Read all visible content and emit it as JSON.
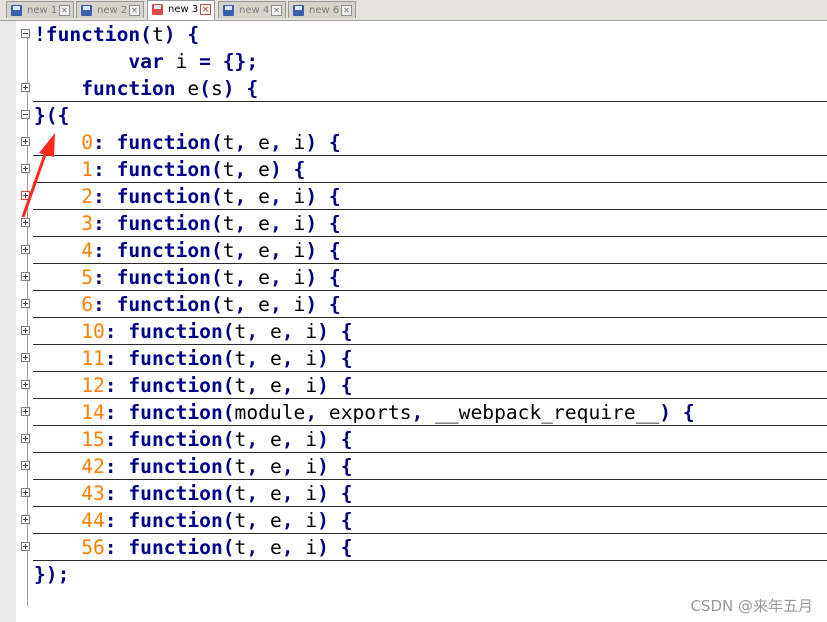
{
  "tabs": [
    {
      "label": "new 1",
      "active": false
    },
    {
      "label": "new 2",
      "active": false
    },
    {
      "label": "new 3",
      "active": true
    },
    {
      "label": "new 4",
      "active": false
    },
    {
      "label": "new 6",
      "active": false
    }
  ],
  "code_lines": [
    {
      "fold": "minus",
      "tokens": [
        [
          "op",
          "!"
        ],
        [
          "kw",
          "function"
        ],
        [
          "op",
          "("
        ],
        [
          "id",
          "t"
        ],
        [
          "op",
          ")"
        ],
        [
          "ws",
          " "
        ],
        [
          "op",
          "{"
        ]
      ]
    },
    {
      "fold": "",
      "tokens": [
        [
          "ws",
          "        "
        ],
        [
          "kw",
          "var"
        ],
        [
          "ws",
          " "
        ],
        [
          "id",
          "i"
        ],
        [
          "ws",
          " "
        ],
        [
          "op",
          "="
        ],
        [
          "ws",
          " "
        ],
        [
          "op",
          "{};"
        ]
      ]
    },
    {
      "fold": "plus",
      "tokens": [
        [
          "ws",
          "    "
        ],
        [
          "kw",
          "function"
        ],
        [
          "ws",
          " "
        ],
        [
          "id",
          "e"
        ],
        [
          "op",
          "("
        ],
        [
          "id",
          "s"
        ],
        [
          "op",
          ")"
        ],
        [
          "ws",
          " "
        ],
        [
          "op",
          "{"
        ]
      ]
    },
    {
      "fold": "minus",
      "tokens": [
        [
          "op",
          "}({"
        ]
      ]
    },
    {
      "fold": "plus",
      "tokens": [
        [
          "ws",
          "    "
        ],
        [
          "num",
          "0"
        ],
        [
          "op",
          ":"
        ],
        [
          "ws",
          " "
        ],
        [
          "kw",
          "function"
        ],
        [
          "op",
          "("
        ],
        [
          "id",
          "t"
        ],
        [
          "op",
          ","
        ],
        [
          "ws",
          " "
        ],
        [
          "id",
          "e"
        ],
        [
          "op",
          ","
        ],
        [
          "ws",
          " "
        ],
        [
          "id",
          "i"
        ],
        [
          "op",
          ")"
        ],
        [
          "ws",
          " "
        ],
        [
          "op",
          "{"
        ]
      ]
    },
    {
      "fold": "plus",
      "tokens": [
        [
          "ws",
          "    "
        ],
        [
          "num",
          "1"
        ],
        [
          "op",
          ":"
        ],
        [
          "ws",
          " "
        ],
        [
          "kw",
          "function"
        ],
        [
          "op",
          "("
        ],
        [
          "id",
          "t"
        ],
        [
          "op",
          ","
        ],
        [
          "ws",
          " "
        ],
        [
          "id",
          "e"
        ],
        [
          "op",
          ")"
        ],
        [
          "ws",
          " "
        ],
        [
          "op",
          "{"
        ]
      ]
    },
    {
      "fold": "plus-red",
      "tokens": [
        [
          "ws",
          "    "
        ],
        [
          "num",
          "2"
        ],
        [
          "op",
          ":"
        ],
        [
          "ws",
          " "
        ],
        [
          "kw",
          "function"
        ],
        [
          "op",
          "("
        ],
        [
          "id",
          "t"
        ],
        [
          "op",
          ","
        ],
        [
          "ws",
          " "
        ],
        [
          "id",
          "e"
        ],
        [
          "op",
          ","
        ],
        [
          "ws",
          " "
        ],
        [
          "id",
          "i"
        ],
        [
          "op",
          ")"
        ],
        [
          "ws",
          " "
        ],
        [
          "op",
          "{"
        ]
      ]
    },
    {
      "fold": "plus",
      "tokens": [
        [
          "ws",
          "    "
        ],
        [
          "num",
          "3"
        ],
        [
          "op",
          ":"
        ],
        [
          "ws",
          " "
        ],
        [
          "kw",
          "function"
        ],
        [
          "op",
          "("
        ],
        [
          "id",
          "t"
        ],
        [
          "op",
          ","
        ],
        [
          "ws",
          " "
        ],
        [
          "id",
          "e"
        ],
        [
          "op",
          ","
        ],
        [
          "ws",
          " "
        ],
        [
          "id",
          "i"
        ],
        [
          "op",
          ")"
        ],
        [
          "ws",
          " "
        ],
        [
          "op",
          "{"
        ]
      ]
    },
    {
      "fold": "plus",
      "tokens": [
        [
          "ws",
          "    "
        ],
        [
          "num",
          "4"
        ],
        [
          "op",
          ":"
        ],
        [
          "ws",
          " "
        ],
        [
          "kw",
          "function"
        ],
        [
          "op",
          "("
        ],
        [
          "id",
          "t"
        ],
        [
          "op",
          ","
        ],
        [
          "ws",
          " "
        ],
        [
          "id",
          "e"
        ],
        [
          "op",
          ","
        ],
        [
          "ws",
          " "
        ],
        [
          "id",
          "i"
        ],
        [
          "op",
          ")"
        ],
        [
          "ws",
          " "
        ],
        [
          "op",
          "{"
        ]
      ]
    },
    {
      "fold": "plus",
      "tokens": [
        [
          "ws",
          "    "
        ],
        [
          "num",
          "5"
        ],
        [
          "op",
          ":"
        ],
        [
          "ws",
          " "
        ],
        [
          "kw",
          "function"
        ],
        [
          "op",
          "("
        ],
        [
          "id",
          "t"
        ],
        [
          "op",
          ","
        ],
        [
          "ws",
          " "
        ],
        [
          "id",
          "e"
        ],
        [
          "op",
          ","
        ],
        [
          "ws",
          " "
        ],
        [
          "id",
          "i"
        ],
        [
          "op",
          ")"
        ],
        [
          "ws",
          " "
        ],
        [
          "op",
          "{"
        ]
      ]
    },
    {
      "fold": "plus",
      "tokens": [
        [
          "ws",
          "    "
        ],
        [
          "num",
          "6"
        ],
        [
          "op",
          ":"
        ],
        [
          "ws",
          " "
        ],
        [
          "kw",
          "function"
        ],
        [
          "op",
          "("
        ],
        [
          "id",
          "t"
        ],
        [
          "op",
          ","
        ],
        [
          "ws",
          " "
        ],
        [
          "id",
          "e"
        ],
        [
          "op",
          ","
        ],
        [
          "ws",
          " "
        ],
        [
          "id",
          "i"
        ],
        [
          "op",
          ")"
        ],
        [
          "ws",
          " "
        ],
        [
          "op",
          "{"
        ]
      ]
    },
    {
      "fold": "plus",
      "tokens": [
        [
          "ws",
          "    "
        ],
        [
          "num",
          "10"
        ],
        [
          "op",
          ":"
        ],
        [
          "ws",
          " "
        ],
        [
          "kw",
          "function"
        ],
        [
          "op",
          "("
        ],
        [
          "id",
          "t"
        ],
        [
          "op",
          ","
        ],
        [
          "ws",
          " "
        ],
        [
          "id",
          "e"
        ],
        [
          "op",
          ","
        ],
        [
          "ws",
          " "
        ],
        [
          "id",
          "i"
        ],
        [
          "op",
          ")"
        ],
        [
          "ws",
          " "
        ],
        [
          "op",
          "{"
        ]
      ]
    },
    {
      "fold": "plus",
      "tokens": [
        [
          "ws",
          "    "
        ],
        [
          "num",
          "11"
        ],
        [
          "op",
          ":"
        ],
        [
          "ws",
          " "
        ],
        [
          "kw",
          "function"
        ],
        [
          "op",
          "("
        ],
        [
          "id",
          "t"
        ],
        [
          "op",
          ","
        ],
        [
          "ws",
          " "
        ],
        [
          "id",
          "e"
        ],
        [
          "op",
          ","
        ],
        [
          "ws",
          " "
        ],
        [
          "id",
          "i"
        ],
        [
          "op",
          ")"
        ],
        [
          "ws",
          " "
        ],
        [
          "op",
          "{"
        ]
      ]
    },
    {
      "fold": "plus",
      "tokens": [
        [
          "ws",
          "    "
        ],
        [
          "num",
          "12"
        ],
        [
          "op",
          ":"
        ],
        [
          "ws",
          " "
        ],
        [
          "kw",
          "function"
        ],
        [
          "op",
          "("
        ],
        [
          "id",
          "t"
        ],
        [
          "op",
          ","
        ],
        [
          "ws",
          " "
        ],
        [
          "id",
          "e"
        ],
        [
          "op",
          ","
        ],
        [
          "ws",
          " "
        ],
        [
          "id",
          "i"
        ],
        [
          "op",
          ")"
        ],
        [
          "ws",
          " "
        ],
        [
          "op",
          "{"
        ]
      ]
    },
    {
      "fold": "plus",
      "tokens": [
        [
          "ws",
          "    "
        ],
        [
          "num",
          "14"
        ],
        [
          "op",
          ":"
        ],
        [
          "ws",
          " "
        ],
        [
          "kw",
          "function"
        ],
        [
          "op",
          "("
        ],
        [
          "id",
          "module"
        ],
        [
          "op",
          ","
        ],
        [
          "ws",
          " "
        ],
        [
          "id",
          "exports"
        ],
        [
          "op",
          ","
        ],
        [
          "ws",
          " "
        ],
        [
          "id",
          "__webpack_require__"
        ],
        [
          "op",
          ")"
        ],
        [
          "ws",
          " "
        ],
        [
          "op",
          "{"
        ]
      ]
    },
    {
      "fold": "plus",
      "tokens": [
        [
          "ws",
          "    "
        ],
        [
          "num",
          "15"
        ],
        [
          "op",
          ":"
        ],
        [
          "ws",
          " "
        ],
        [
          "kw",
          "function"
        ],
        [
          "op",
          "("
        ],
        [
          "id",
          "t"
        ],
        [
          "op",
          ","
        ],
        [
          "ws",
          " "
        ],
        [
          "id",
          "e"
        ],
        [
          "op",
          ","
        ],
        [
          "ws",
          " "
        ],
        [
          "id",
          "i"
        ],
        [
          "op",
          ")"
        ],
        [
          "ws",
          " "
        ],
        [
          "op",
          "{"
        ]
      ]
    },
    {
      "fold": "plus",
      "tokens": [
        [
          "ws",
          "    "
        ],
        [
          "num",
          "42"
        ],
        [
          "op",
          ":"
        ],
        [
          "ws",
          " "
        ],
        [
          "kw",
          "function"
        ],
        [
          "op",
          "("
        ],
        [
          "id",
          "t"
        ],
        [
          "op",
          ","
        ],
        [
          "ws",
          " "
        ],
        [
          "id",
          "e"
        ],
        [
          "op",
          ","
        ],
        [
          "ws",
          " "
        ],
        [
          "id",
          "i"
        ],
        [
          "op",
          ")"
        ],
        [
          "ws",
          " "
        ],
        [
          "op",
          "{"
        ]
      ]
    },
    {
      "fold": "plus",
      "tokens": [
        [
          "ws",
          "    "
        ],
        [
          "num",
          "43"
        ],
        [
          "op",
          ":"
        ],
        [
          "ws",
          " "
        ],
        [
          "kw",
          "function"
        ],
        [
          "op",
          "("
        ],
        [
          "id",
          "t"
        ],
        [
          "op",
          ","
        ],
        [
          "ws",
          " "
        ],
        [
          "id",
          "e"
        ],
        [
          "op",
          ","
        ],
        [
          "ws",
          " "
        ],
        [
          "id",
          "i"
        ],
        [
          "op",
          ")"
        ],
        [
          "ws",
          " "
        ],
        [
          "op",
          "{"
        ]
      ]
    },
    {
      "fold": "plus",
      "tokens": [
        [
          "ws",
          "    "
        ],
        [
          "num",
          "44"
        ],
        [
          "op",
          ":"
        ],
        [
          "ws",
          " "
        ],
        [
          "kw",
          "function"
        ],
        [
          "op",
          "("
        ],
        [
          "id",
          "t"
        ],
        [
          "op",
          ","
        ],
        [
          "ws",
          " "
        ],
        [
          "id",
          "e"
        ],
        [
          "op",
          ","
        ],
        [
          "ws",
          " "
        ],
        [
          "id",
          "i"
        ],
        [
          "op",
          ")"
        ],
        [
          "ws",
          " "
        ],
        [
          "op",
          "{"
        ]
      ]
    },
    {
      "fold": "plus",
      "tokens": [
        [
          "ws",
          "    "
        ],
        [
          "num",
          "56"
        ],
        [
          "op",
          ":"
        ],
        [
          "ws",
          " "
        ],
        [
          "kw",
          "function"
        ],
        [
          "op",
          "("
        ],
        [
          "id",
          "t"
        ],
        [
          "op",
          ","
        ],
        [
          "ws",
          " "
        ],
        [
          "id",
          "e"
        ],
        [
          "op",
          ","
        ],
        [
          "ws",
          " "
        ],
        [
          "id",
          "i"
        ],
        [
          "op",
          ")"
        ],
        [
          "ws",
          " "
        ],
        [
          "op",
          "{"
        ]
      ]
    },
    {
      "fold": "",
      "tokens": [
        [
          "op",
          "});"
        ]
      ]
    }
  ],
  "watermark": "CSDN @来年五月",
  "colors": {
    "keyword": "#00008b",
    "number": "#ff8000",
    "operator": "#000080",
    "annotation_arrow": "#ff2a1a"
  }
}
